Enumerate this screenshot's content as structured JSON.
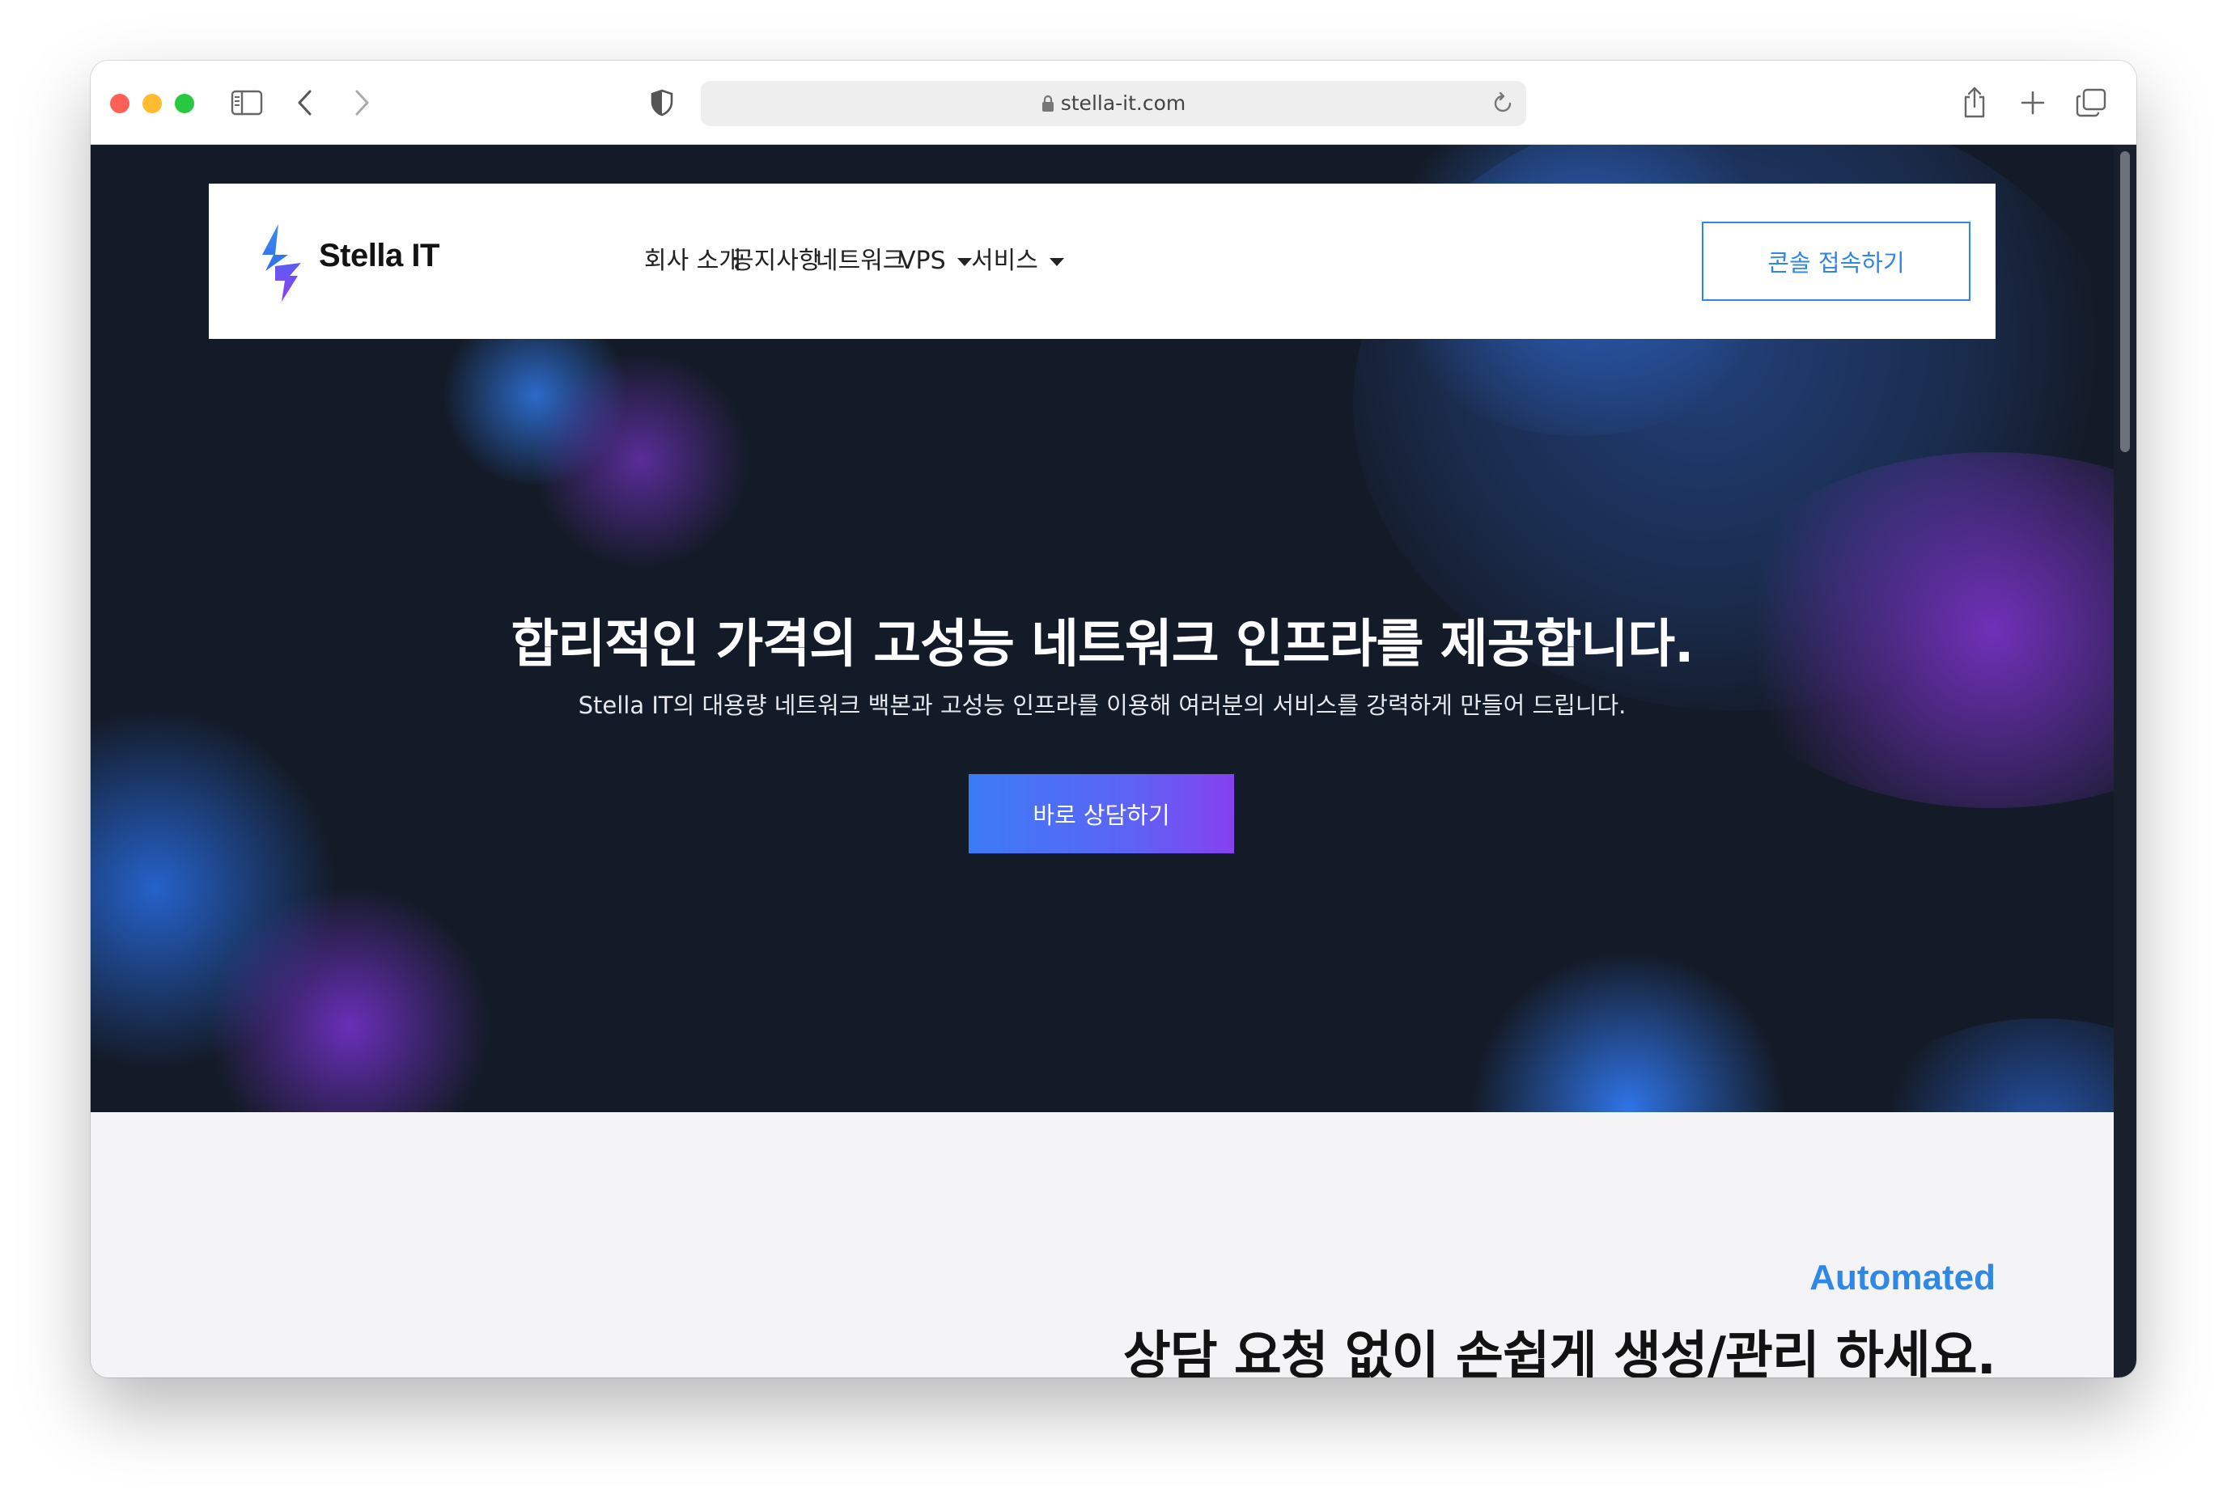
{
  "browser": {
    "url": "stella-it.com"
  },
  "site": {
    "brand": "Stella IT",
    "nav": {
      "items": [
        {
          "label": "회사 소개"
        },
        {
          "label": "공지사항"
        },
        {
          "label": "네트워크"
        },
        {
          "label": "VPS"
        },
        {
          "label": "서비스"
        }
      ],
      "console_button": "콘솔 접속하기"
    },
    "hero": {
      "title": "합리적인 가격의 고성능 네트워크 인프라를 제공합니다.",
      "subtitle": "Stella IT의 대용량 네트워크 백본과 고성능 인프라를 이용해 여러분의 서비스를 강력하게 만들어 드립니다.",
      "cta": "바로 상담하기"
    },
    "section2": {
      "label": "Automated",
      "title": "상담 요청 없이 손쉽게 생성/관리 하세요."
    }
  },
  "icons": {
    "toolbar": [
      "sidebar-icon",
      "back-icon",
      "forward-icon",
      "shield-icon",
      "lock-icon",
      "reload-icon",
      "share-icon",
      "new-tab-icon",
      "tabs-overview-icon"
    ],
    "nav_dropdown": "caret-down-icon"
  },
  "colors": {
    "accent_blue": "#2e86e8",
    "hero_background": "#141b28",
    "cta_gradient_start": "#3c7bf5",
    "cta_gradient_end": "#8640ef"
  }
}
